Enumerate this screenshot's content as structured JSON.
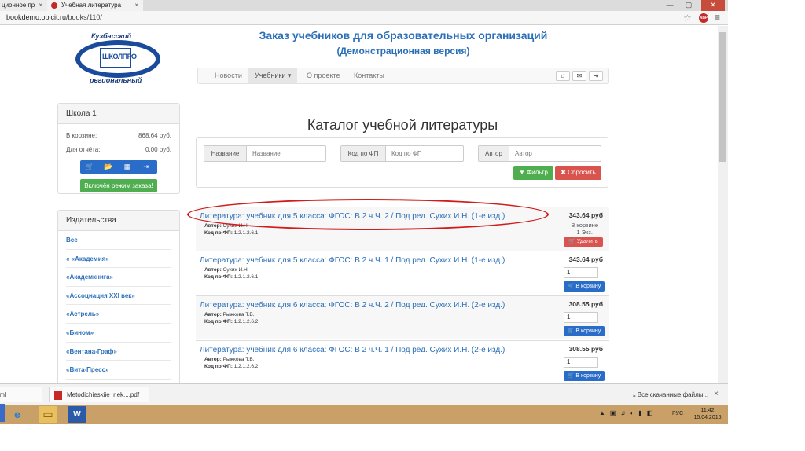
{
  "browser": {
    "tabs": [
      {
        "label": "ционное пр"
      },
      {
        "label": "Учебная литература"
      }
    ],
    "url_host": "bookdemo.oblcit.ru",
    "url_path": "/books/110/",
    "abp_label": "ABP"
  },
  "header": {
    "logo_top": "Кузбасский",
    "logo_middle": "ШКОЛПРО",
    "logo_bottom": "региональный",
    "title": "Заказ учебников для образовательных организаций",
    "subtitle": "(Демонстрационная версия)"
  },
  "nav": {
    "items": [
      "Новости",
      "Учебники ▾",
      "О проекте",
      "Контакты"
    ],
    "buttons": [
      "⌂",
      "✉",
      "⇥"
    ]
  },
  "school": {
    "title": "Школа 1",
    "cart_label": "В корзине:",
    "cart_value": "868.64 руб.",
    "report_label": "Для отчёта:",
    "report_value": "0.00 руб.",
    "icons": [
      "🛒",
      "📂",
      "▦",
      "⇥"
    ],
    "order_button": "Включён режим заказа!"
  },
  "publishers": {
    "title": "Издательства",
    "items": [
      "Все",
      "« «Академия»",
      "«Академкнига»",
      "«Ассоциация XXI век»",
      "«Астрель»",
      "«Бином»",
      "«Вентана-Граф»",
      "«Вита-Пресс»"
    ]
  },
  "catalog": {
    "title": "Каталог учебной литературы",
    "filters": [
      {
        "label": "Название",
        "placeholder": "Название"
      },
      {
        "label": "Код по ФП",
        "placeholder": "Код по ФП"
      },
      {
        "label": "Автор",
        "placeholder": "Автор"
      }
    ],
    "filter_button": "▼ Фильтр",
    "reset_button": "✖ Сбросить",
    "author_label": "Автор:",
    "code_label": "Код по ФП:",
    "in_cart_label": "В корзине",
    "remove_button": "🛒 Удалить",
    "add_button": "🛒 В корзину",
    "books": [
      {
        "title": "Литература: учебник для 5 класса: ФГОС: В 2 ч.Ч. 2 / Под ред. Сухих И.Н. (1-е изд.)",
        "author": "Сухих И.Н.",
        "code": "1.2.1.2.6.1",
        "price": "343.64 руб",
        "in_cart_qty": "1 Экз."
      },
      {
        "title": "Литература: учебник для 5 класса: ФГОС: В 2 ч.Ч. 1 / Под ред. Сухих И.Н. (1-е изд.)",
        "author": "Сухих И.Н.",
        "code": "1.2.1.2.6.1",
        "price": "343.64 руб",
        "qty": "1"
      },
      {
        "title": "Литература: учебник для 6 класса: ФГОС: В 2 ч.Ч. 2 / Под ред. Сухих И.Н. (2-е изд.)",
        "author": "Рыжкова Т.В.",
        "code": "1.2.1.2.6.2",
        "price": "308.55 руб",
        "qty": "1"
      },
      {
        "title": "Литература: учебник для 6 класса: ФГОС: В 2 ч.Ч. 1 / Под ред. Сухих И.Н. (2-е изд.)",
        "author": "Рыжкова Т.В.",
        "code": "1.2.1.2.6.2",
        "price": "308.55 руб",
        "qty": "1"
      }
    ]
  },
  "downloads": {
    "item1": "tml",
    "item2": "Metodichieskiie_riek....pdf",
    "all_label": "Все скачанные файлы...",
    "close": "×"
  },
  "taskbar": {
    "lang": "РУС",
    "time": "11:42",
    "date": "15.04.2016"
  },
  "colors": {
    "link_blue": "#2a6fb8",
    "primary_button": "#2a6dc8",
    "success_button": "#4fae4f",
    "danger_button": "#d9534f",
    "highlight_oval": "#d01c1c"
  }
}
